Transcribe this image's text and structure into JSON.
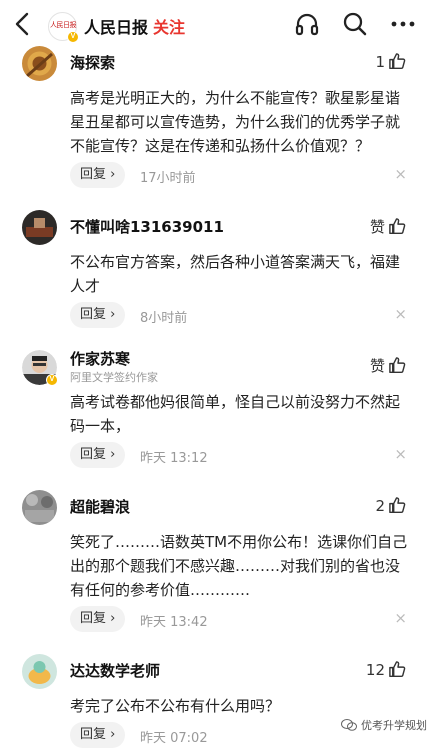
{
  "header": {
    "source_name": "人民日报",
    "follow_label": "关注",
    "logo_text": "人民日报",
    "verified_mark": "V"
  },
  "icons": {
    "back": "chevron-left-icon",
    "headphones": "headphones-icon",
    "search": "search-icon",
    "more": "more-dots-icon",
    "like": "thumbs-up-icon"
  },
  "colors": {
    "follow": "#e8362f",
    "verified": "#f5b700",
    "meta": "#999999",
    "reply_bg": "#f2f2f2"
  },
  "comments": [
    {
      "name": "海探索",
      "subtitle": "",
      "like_count": "1",
      "text": "高考是光明正大的，为什么不能宣传？歌星影星谐星丑星都可以宣传造势，为什么我们的优秀学子就不能宣传？这是在传递和弘扬什么价值观？？",
      "reply_label": "回复",
      "time": "17小时前",
      "close": "×"
    },
    {
      "name": "不懂叫啥131639011",
      "subtitle": "",
      "like_count": "赞",
      "text": "不公布官方答案，然后各种小道答案满天飞，福建人才",
      "reply_label": "回复",
      "time": "8小时前",
      "close": "×"
    },
    {
      "name": "作家苏寒",
      "subtitle": "阿里文学签约作家",
      "like_count": "赞",
      "text": "高考试卷都他妈很简单，怪自己以前没努力不然起码一本，",
      "reply_label": "回复",
      "time": "昨天 13:12",
      "close": "×"
    },
    {
      "name": "超能碧浪",
      "subtitle": "",
      "like_count": "2",
      "text": "笑死了………语数英TM不用你公布！选课你们自己出的那个题我们不感兴趣………对我们别的省也没有任何的参考价值…………",
      "reply_label": "回复",
      "time": "昨天 13:42",
      "close": "×"
    },
    {
      "name": "达达数学老师",
      "subtitle": "",
      "like_count": "12",
      "text": "考完了公布不公布有什么用吗？",
      "reply_label": "回复",
      "time": "昨天 07:02",
      "close": ""
    }
  ],
  "watermark": {
    "text": "优考升学规划"
  }
}
